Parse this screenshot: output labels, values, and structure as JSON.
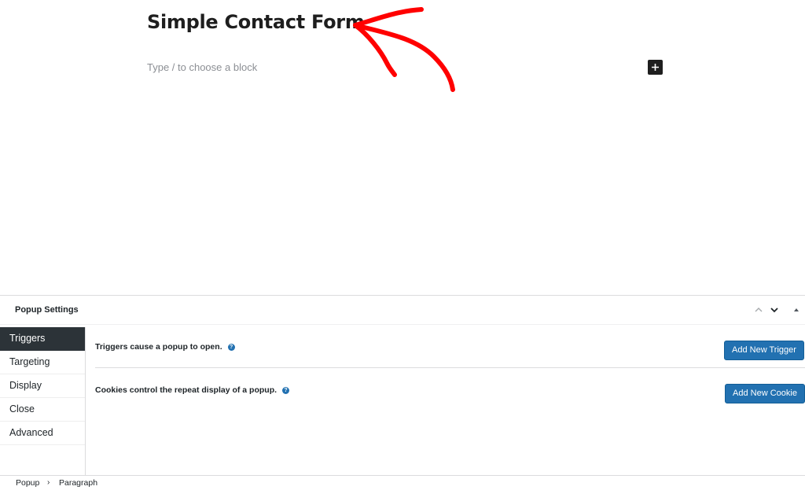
{
  "editor": {
    "post_title": "Simple Contact Form",
    "block_placeholder": "Type / to choose a block"
  },
  "colors": {
    "annotation_arrow": "#ff0000",
    "primary_button": "#2271b1",
    "active_tab": "#2c3338"
  },
  "metabox": {
    "title": "Popup Settings",
    "controls": [
      "chevron-up-icon",
      "chevron-down-icon",
      "triangle-up-icon"
    ],
    "tabs": [
      {
        "label": "Triggers",
        "active": true
      },
      {
        "label": "Targeting",
        "active": false
      },
      {
        "label": "Display",
        "active": false
      },
      {
        "label": "Close",
        "active": false
      },
      {
        "label": "Advanced",
        "active": false
      }
    ],
    "triggers": {
      "label": "Triggers cause a popup to open.",
      "button": "Add New Trigger"
    },
    "cookies": {
      "label": "Cookies control the repeat display of a popup.",
      "button": "Add New Cookie"
    }
  },
  "breadcrumbs": [
    "Popup",
    "Paragraph"
  ]
}
